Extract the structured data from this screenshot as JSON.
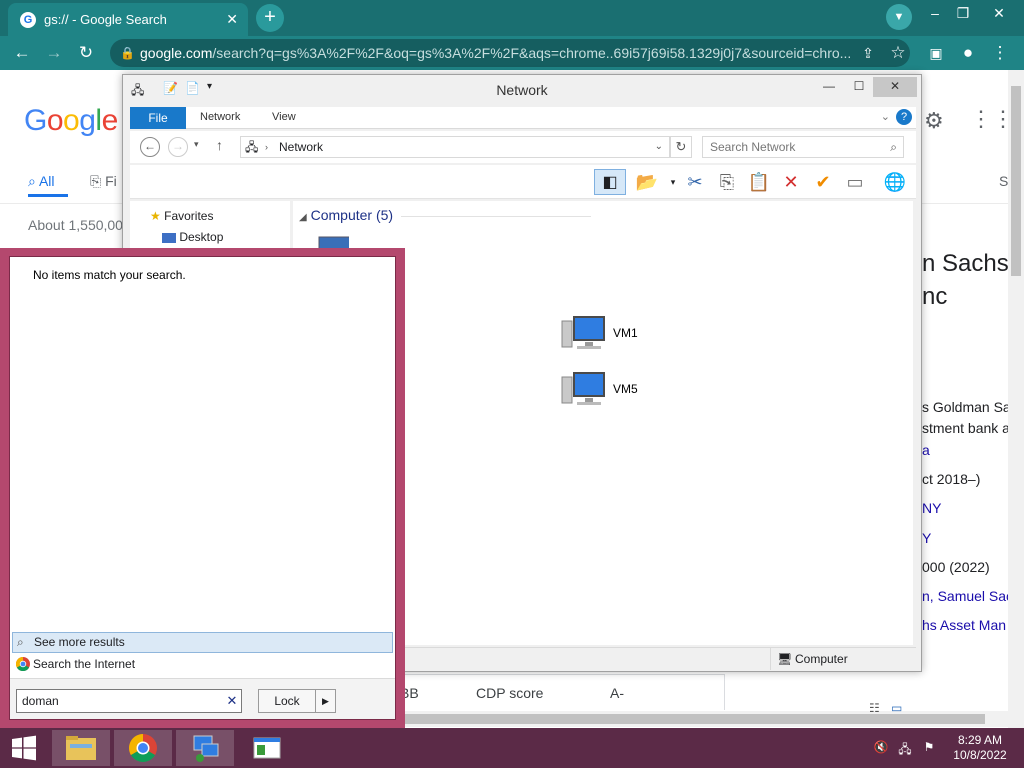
{
  "browser": {
    "tab_title": "gs:// - Google Search",
    "url_host": "google.com",
    "url_rest": "/search?q=gs%3A%2F%2F&oq=gs%3A%2F%2F&aqs=chrome..69i57j69i58.1329j0j7&sourceid=chro..."
  },
  "google": {
    "logo": "Google",
    "tabs": {
      "all": "All",
      "second": "Fi",
      "tools": "S"
    },
    "about": "About 1,550,00",
    "knowledge_panel": {
      "title_line1": "n Sachs",
      "title_line2": "nc",
      "desc_line1": "s Goldman Sa",
      "desc_line2": "stment bank ar",
      "desc_line3": "a",
      "row1": "ct 2018–)",
      "row2": "NY",
      "row3": "Y",
      "row4": "000 (2022)",
      "row5": "n, Samuel Sac",
      "row6": "hs Asset Man"
    },
    "bottom_row": {
      "col1": "BB",
      "col2": "CDP score",
      "col3": "A-"
    }
  },
  "explorer": {
    "title": "Network",
    "ribbon_tabs": {
      "file": "File",
      "network": "Network",
      "view": "View"
    },
    "address": "Network",
    "search_placeholder": "Search Network",
    "nav": {
      "favorites": "Favorites",
      "desktop": "Desktop"
    },
    "group_header": "Computer (5)",
    "computers": [
      "VM1",
      "VM5"
    ],
    "status_item": "Computer"
  },
  "start_search": {
    "no_items": "No items match your search.",
    "see_more": "See more results",
    "search_internet": "Search the Internet",
    "query": "doman",
    "lock_label": "Lock"
  },
  "taskbar": {
    "time": "8:29 AM",
    "date": "10/8/2022"
  },
  "colors": {
    "chrome_tab": "#1a6f71",
    "chrome_toolbar": "#1f8486",
    "start_border": "#b4486e",
    "taskbar": "#5b2a47",
    "ribbon_file": "#1979ca"
  }
}
